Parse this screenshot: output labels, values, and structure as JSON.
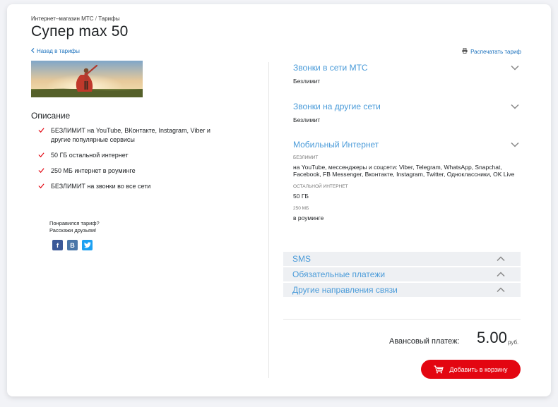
{
  "breadcrumb": {
    "shop": "Интернет–магазин МТС",
    "sep": "/",
    "current": "Тарифы"
  },
  "page_title": "Супер max 50",
  "back_link": "Назад в тарифы",
  "print_link": "Распечатать тариф",
  "description": {
    "title": "Описание",
    "features": [
      "БЕЗЛИМИТ на YouTube, ВКонтакте, Instagram, Viber и другие популярные сервисы",
      "50 ГБ остальной интернет",
      "250 МБ интернет в роуминге",
      "БЕЗЛИМИТ на звонки во все сети"
    ]
  },
  "share": {
    "line1": "Понравился тариф?",
    "line2": "Расскажи друзьям!",
    "buttons": [
      "f",
      "B",
      "t"
    ]
  },
  "accordion_open": [
    {
      "title": "Звонки в сети МТС",
      "value": "Безлимит"
    },
    {
      "title": "Звонки на другие сети",
      "value": "Безлимит"
    },
    {
      "title": "Мобильный Интернет",
      "items": [
        {
          "label": "БЕЗЛИМИТ",
          "value": "на YouTube, мессенджеры и соцсети: Viber, Telegram, WhatsApp, Snapchat, Facebook, FB Messenger, Вконтакте, Instagram, Twitter, Одноклассники, OK Live"
        },
        {
          "label": "ОСТАЛЬНОЙ ИНТЕРНЕТ",
          "value": "50 ГБ"
        },
        {
          "label": "250 МБ",
          "value": "в роуминге"
        }
      ]
    }
  ],
  "accordion_closed": [
    "SMS",
    "Обязательные платежи",
    "Другие направления связи"
  ],
  "price": {
    "label": "Авансовый платеж:",
    "value": "5.00",
    "currency": "руб."
  },
  "cart_button": "Добавить в корзину",
  "colors": {
    "accent": "#4a9bd9",
    "brand_red": "#e30611",
    "link": "#1e73be"
  }
}
